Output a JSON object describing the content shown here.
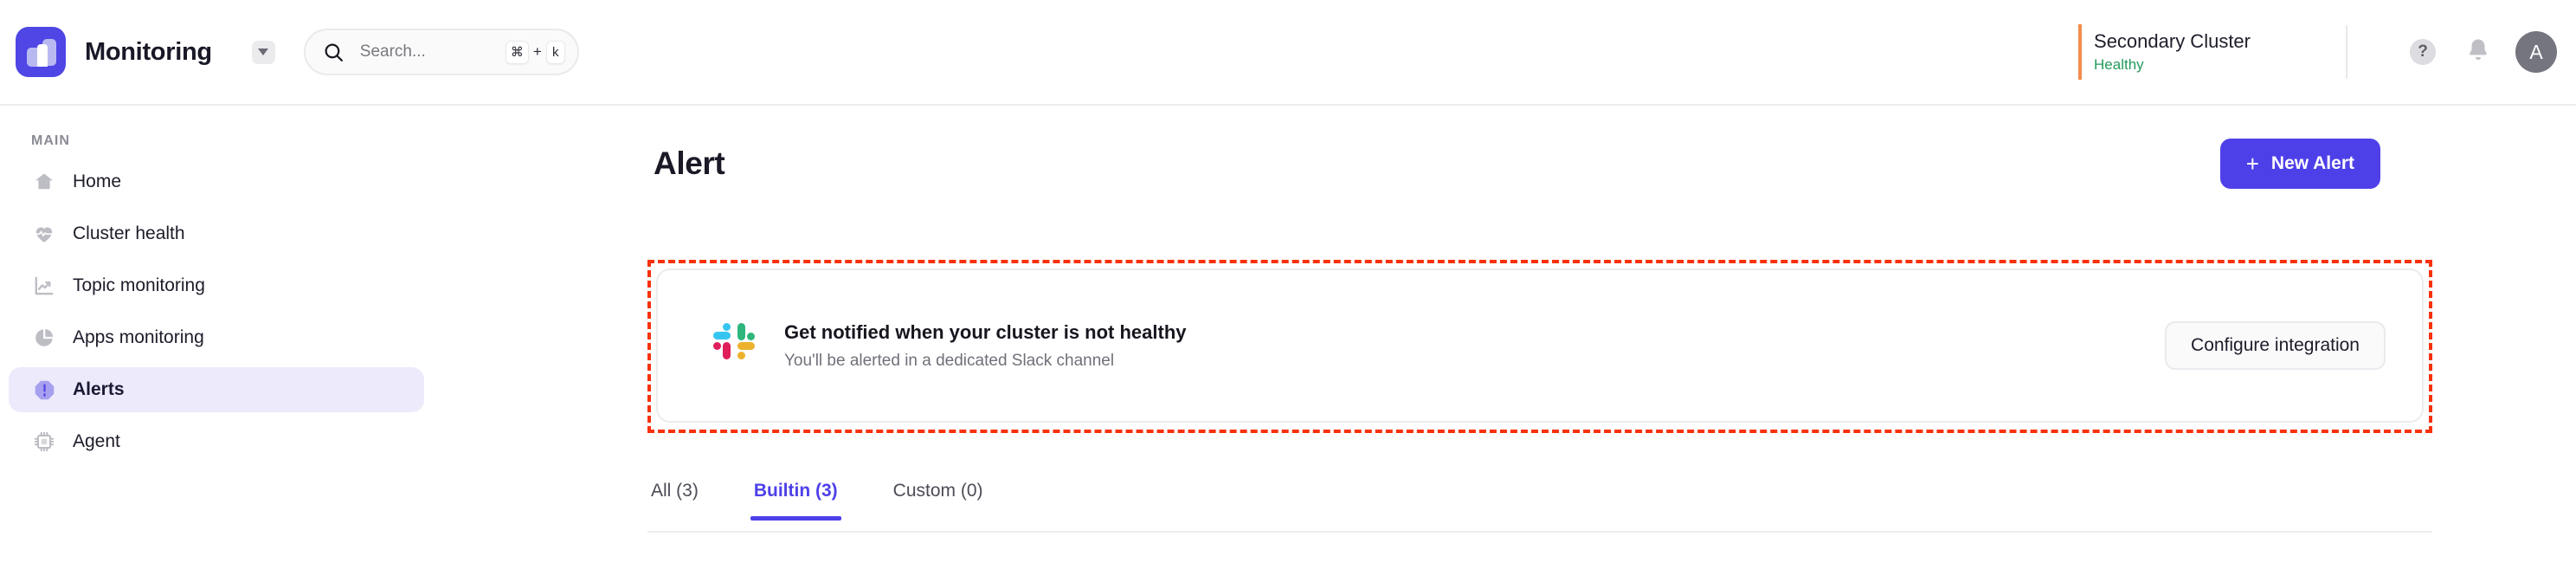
{
  "header": {
    "logo_icon": "app-logo-icon",
    "brand_title": "Monitoring",
    "caret_icon": "chevron-down-icon",
    "search": {
      "icon": "search-icon",
      "placeholder": "Search...",
      "shortcut_key_1": "⌘",
      "shortcut_plus": "+",
      "shortcut_key_2": "k"
    },
    "cluster": {
      "name": "Secondary Cluster",
      "status": "Healthy",
      "status_color": "#239a5c",
      "accent_color": "#f58b4c"
    },
    "help_icon": "help-question-icon",
    "help_glyph": "?",
    "bell_icon": "notification-bell-icon",
    "avatar_initial": "A"
  },
  "sidebar": {
    "section_label": "MAIN",
    "items": [
      {
        "label": "Home",
        "icon": "home-icon",
        "active": false
      },
      {
        "label": "Cluster health",
        "icon": "heart-pulse-icon",
        "active": false
      },
      {
        "label": "Topic monitoring",
        "icon": "line-chart-icon",
        "active": false
      },
      {
        "label": "Apps monitoring",
        "icon": "pie-chart-icon",
        "active": false
      },
      {
        "label": "Alerts",
        "icon": "alert-octagon-icon",
        "active": true
      },
      {
        "label": "Agent",
        "icon": "cpu-chip-icon",
        "active": false
      }
    ],
    "active_bg": "#eceafb"
  },
  "main": {
    "page_title": "Alert",
    "new_alert_button": {
      "label": "New Alert",
      "plus_icon": "plus-icon",
      "plus_glyph": "+",
      "color": "#4e40e8"
    },
    "banner": {
      "outline_color": "#f8310b",
      "icon": "slack-logo-icon",
      "title": "Get notified when your cluster is not healthy",
      "subtitle": "You'll be alerted in a dedicated Slack channel",
      "button_label": "Configure integration"
    },
    "tabs": [
      {
        "label": "All (3)",
        "active": false
      },
      {
        "label": "Builtin (3)",
        "active": true
      },
      {
        "label": "Custom (0)",
        "active": false
      }
    ],
    "accent_color": "#4e40e8"
  }
}
